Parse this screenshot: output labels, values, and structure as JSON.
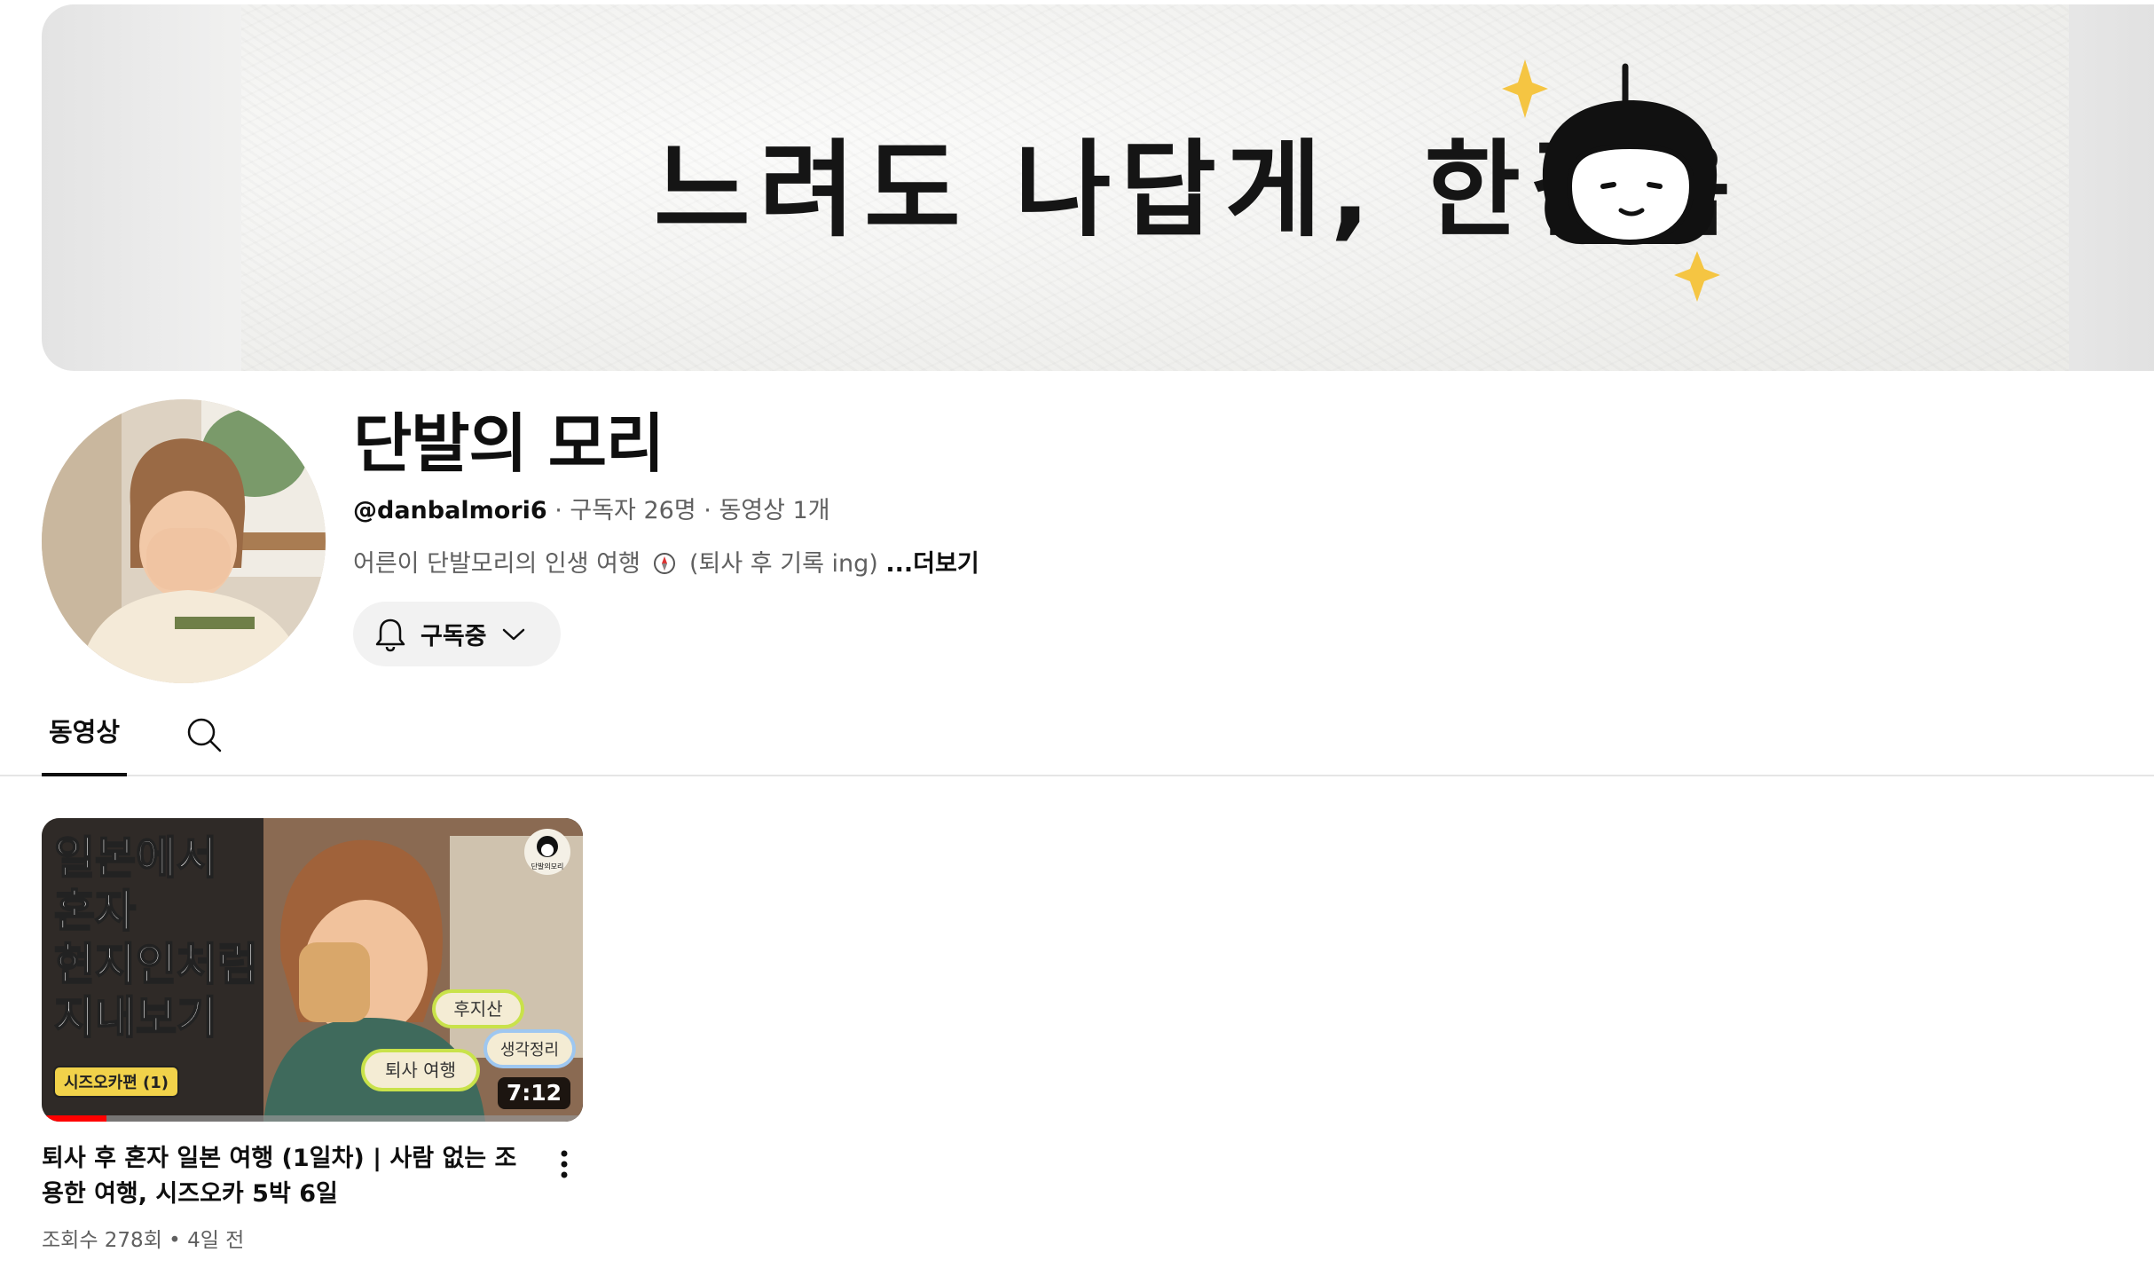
{
  "banner": {
    "text": "느려도 나답게, 한걸음"
  },
  "channel": {
    "name": "단발의 모리",
    "handle": "@danbalmori6",
    "subscribers": "구독자 26명",
    "video_count": "동영상 1개",
    "separator": " · ",
    "description": "어른이 단발모리의 인생 여행",
    "description_suffix": "(퇴사 후 기록 ing)",
    "more_label": "...더보기",
    "subscribe_label": "구독중"
  },
  "tabs": {
    "videos_label": "동영상"
  },
  "videos": [
    {
      "thumbnail": {
        "lines": [
          "일본에서",
          "혼자",
          "현지인처럼",
          "지내보기"
        ],
        "badge": "시즈오카편 (1)",
        "tags": [
          "후지산",
          "생각정리",
          "퇴사 여행"
        ],
        "logo_text": "단발의모리"
      },
      "duration": "7:12",
      "progress": 0.12,
      "title": "퇴사 후 혼자 일본 여행 (1일차) | 사람 없는 조용한 여행, 시즈오카 5박 6일",
      "views": "조회수 278회",
      "age": "4일 전",
      "meta_separator": " • "
    }
  ],
  "colors": {
    "text_primary": "#0f0f0f",
    "text_secondary": "#606060",
    "button_bg": "#f2f2f2",
    "progress": "#ff0000",
    "banner_star": "#f5c542"
  },
  "icons": {
    "subscribe": "bell-icon",
    "dropdown": "chevron-down-icon",
    "tab_search": "search-icon",
    "video_menu": "more-vertical-icon",
    "description_emoji": "compass-icon"
  }
}
